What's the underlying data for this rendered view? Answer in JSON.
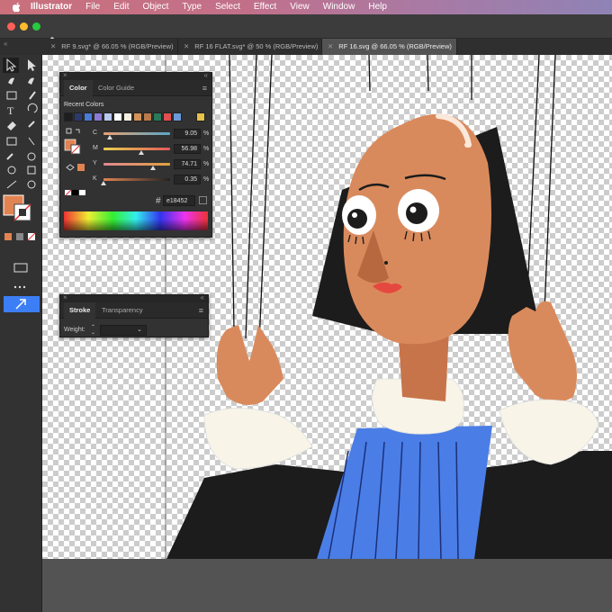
{
  "menubar": {
    "app": "Illustrator",
    "items": [
      "File",
      "Edit",
      "Object",
      "Type",
      "Select",
      "Effect",
      "View",
      "Window",
      "Help"
    ]
  },
  "tabs": [
    {
      "label": "RF 9.svg* @ 66.05 % (RGB/Preview)",
      "active": false
    },
    {
      "label": "RF 16 FLAT.svg* @ 50 % (RGB/Preview)",
      "active": false
    },
    {
      "label": "RF 16.svg @ 66.05 % (RGB/Preview)",
      "active": true
    }
  ],
  "color_panel": {
    "tab_color": "Color",
    "tab_guide": "Color Guide",
    "recent_label": "Recent Colors",
    "recent_colors": [
      "#1e1e1e",
      "#2b3a6b",
      "#4a7bd6",
      "#8a7ad4",
      "#b8c8f0",
      "#ffffff",
      "#f5f0e0",
      "#d4925a",
      "#b87a4a",
      "#2a7a5a",
      "#e05050",
      "#6a9ad8",
      "#e6c24a"
    ],
    "channels": [
      {
        "name": "C",
        "value": "9.05",
        "unit": "%",
        "level": 0.0905
      },
      {
        "name": "M",
        "value": "56.98",
        "unit": "%",
        "level": 0.5698
      },
      {
        "name": "Y",
        "value": "74.71",
        "unit": "%",
        "level": 0.7471
      },
      {
        "name": "K",
        "value": "0.35",
        "unit": "%",
        "level": 0.0035
      }
    ],
    "hex_prefix": "#",
    "hex_value": "e18452",
    "fill_color": "#e18452"
  },
  "stroke_panel": {
    "tab_stroke": "Stroke",
    "tab_transparency": "Transparency",
    "weight_label": "Weight:",
    "weight_value": ""
  },
  "artwork": {
    "skin": "#d98a5c",
    "skin_shadow": "#b8683f",
    "hair": "#1c1c1c",
    "ruff": "#f8f4e8",
    "robe_blue": "#4a7ee6",
    "robe_dark": "#2a56b8",
    "lips": "#e5483e",
    "highlight": "#fbe8da"
  }
}
